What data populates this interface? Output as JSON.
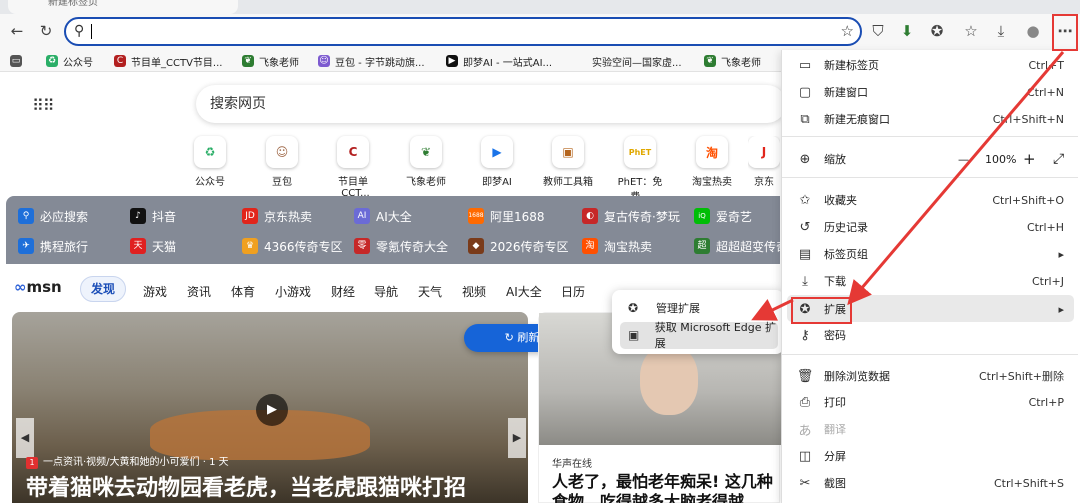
{
  "tab": {
    "title": "新建标签页"
  },
  "address": {
    "value": ""
  },
  "bookmarks": [
    {
      "label": "",
      "icon": "reading-list-icon",
      "color": "#333"
    },
    {
      "label": "公众号",
      "icon": "wechat-icon",
      "color": "#2aae67"
    },
    {
      "label": "节目单_CCTV节目...",
      "icon": "cctv-icon",
      "color": "#b32020"
    },
    {
      "label": "飞象老师",
      "icon": "feixiang-icon",
      "color": "#2e7d32"
    },
    {
      "label": "豆包 - 字节跳动旗...",
      "icon": "doubao-icon",
      "color": "#7d5bd0"
    },
    {
      "label": "即梦AI - 一站式AI...",
      "icon": "jimeng-icon",
      "color": "#111"
    },
    {
      "label": "实验空间—国家虚...",
      "icon": "",
      "color": ""
    },
    {
      "label": "飞象老师",
      "icon": "feixiang-icon",
      "color": "#2e7d32"
    }
  ],
  "search": {
    "placeholder": "搜索网页"
  },
  "tiles": [
    {
      "label": "公众号",
      "glyph": "♻",
      "color": "#2aae67"
    },
    {
      "label": "豆包",
      "glyph": "☺",
      "color": "#a06a4a"
    },
    {
      "label": "节目单_CCT...",
      "glyph": "C",
      "color": "#b32020"
    },
    {
      "label": "飞象老师",
      "glyph": "❦",
      "color": "#2e7d32"
    },
    {
      "label": "即梦AI",
      "glyph": "▶",
      "color": "#1a73e8"
    },
    {
      "label": "教师工具箱",
      "glyph": "▣",
      "color": "#b5651d"
    },
    {
      "label": "PhET：免费...",
      "glyph": "PhET",
      "color": "#e0a800"
    },
    {
      "label": "淘宝热卖",
      "glyph": "淘",
      "color": "#ff5000"
    },
    {
      "label": "京东",
      "glyph": "J",
      "color": "#e1251b"
    }
  ],
  "hotnav": {
    "row1": [
      {
        "label": "必应搜索",
        "color": "#1e6fd9",
        "glyph": "🔍"
      },
      {
        "label": "抖音",
        "color": "#111",
        "glyph": "♪"
      },
      {
        "label": "京东热卖",
        "color": "#e1251b",
        "glyph": "JD"
      },
      {
        "label": "AI大全",
        "color": "#6b6bd6",
        "glyph": "AI"
      },
      {
        "label": "阿里1688",
        "color": "#ff6a00",
        "glyph": "1688"
      },
      {
        "label": "复古传奇·梦玩",
        "color": "#c62828",
        "glyph": "◐"
      },
      {
        "label": "爱奇艺",
        "color": "#00be06",
        "glyph": "iQ"
      }
    ],
    "row2": [
      {
        "label": "携程旅行",
        "color": "#1e6fd9",
        "glyph": "✈"
      },
      {
        "label": "天猫",
        "color": "#e02020",
        "glyph": "天"
      },
      {
        "label": "4366传奇专区",
        "color": "#f0a020",
        "glyph": "♛"
      },
      {
        "label": "零氪传奇大全",
        "color": "#c62828",
        "glyph": "零"
      },
      {
        "label": "2026传奇专区",
        "color": "#7a3b1a",
        "glyph": "◆"
      },
      {
        "label": "淘宝热卖",
        "color": "#ff5000",
        "glyph": "淘"
      },
      {
        "label": "超超超变传奇",
        "color": "#2e7d32",
        "glyph": "超"
      }
    ]
  },
  "msn": {
    "logo_m": "∞",
    "logo_text": "msn",
    "tabs": [
      "发现",
      "游戏",
      "资讯",
      "体育",
      "小游戏",
      "财经",
      "导航",
      "天气",
      "视频",
      "AI大全",
      "日历"
    ]
  },
  "refresh_label": "刷新内容",
  "card1": {
    "source": "一点资讯·视频/大黄和她的小可爱们 · 1 天",
    "source_badge": "1",
    "headline": "带着猫咪去动物园看老虎，当老虎跟猫咪打招"
  },
  "card2": {
    "source": "华声在线",
    "headline": "人老了，最怕老年痴呆! 这几种食物，吃得越多大脑老得越"
  },
  "extensions_popup": {
    "manage": "管理扩展",
    "get": "获取 Microsoft Edge 扩展"
  },
  "menu": {
    "new_tab": {
      "label": "新建标签页",
      "shortcut": "Ctrl+T"
    },
    "new_window": {
      "label": "新建窗口",
      "shortcut": "Ctrl+N"
    },
    "new_inprivate": {
      "label": "新建无痕窗口",
      "shortcut": "Ctrl+Shift+N"
    },
    "zoom": {
      "label": "缩放",
      "value": "100%",
      "minus": "—",
      "plus": "+",
      "full": "⤢"
    },
    "favorites": {
      "label": "收藏夹",
      "shortcut": "Ctrl+Shift+O"
    },
    "history": {
      "label": "历史记录",
      "shortcut": "Ctrl+H"
    },
    "tab_groups": {
      "label": "标签页组",
      "shortcut": "▸"
    },
    "downloads": {
      "label": "下载",
      "shortcut": "Ctrl+J"
    },
    "extensions": {
      "label": "扩展",
      "shortcut": "▸"
    },
    "passwords": {
      "label": "密码",
      "shortcut": ""
    },
    "clear": {
      "label": "删除浏览数据",
      "shortcut": "Ctrl+Shift+删除"
    },
    "print": {
      "label": "打印",
      "shortcut": "Ctrl+P"
    },
    "translate": {
      "label": "翻译",
      "shortcut": ""
    },
    "split": {
      "label": "分屏",
      "shortcut": ""
    },
    "screenshot": {
      "label": "截图",
      "shortcut": "Ctrl+Shift+S"
    }
  }
}
